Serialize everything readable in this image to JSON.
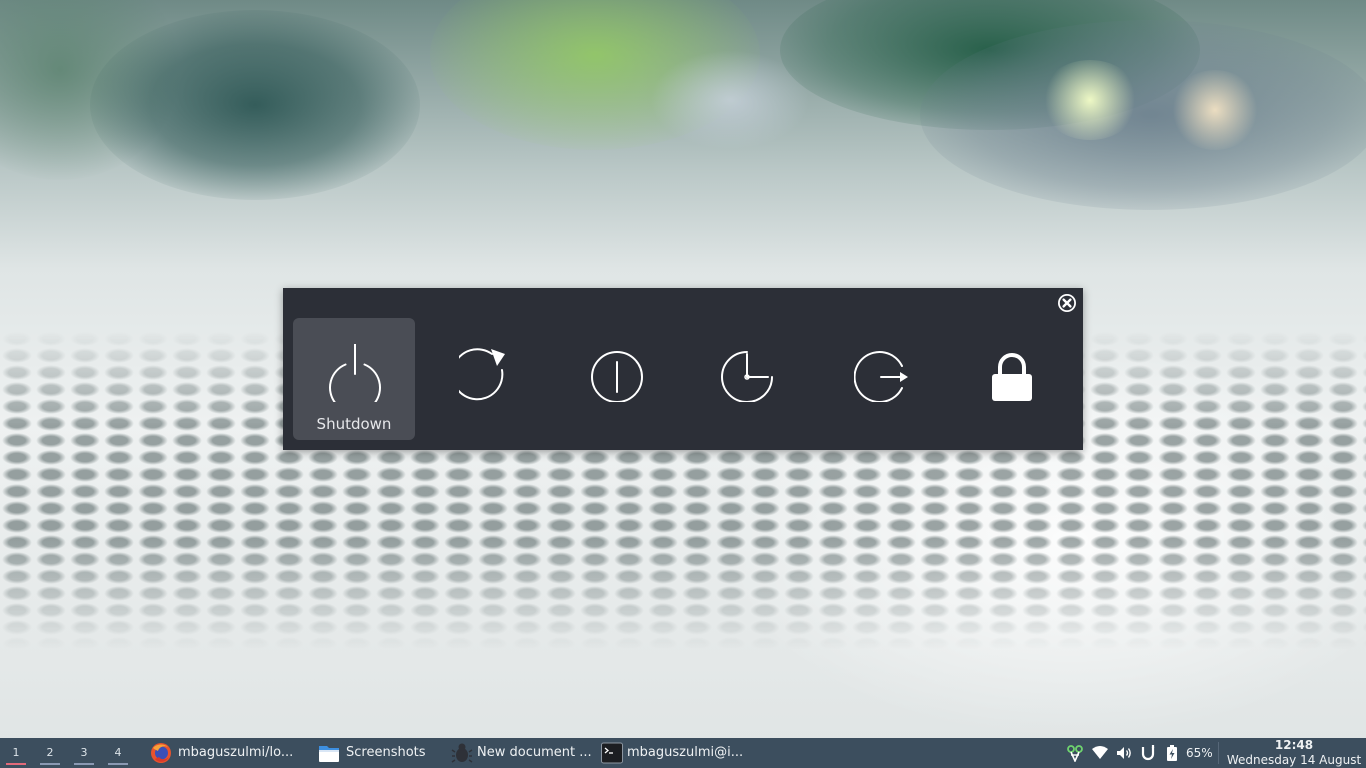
{
  "dialog": {
    "options": [
      {
        "id": "shutdown",
        "label": "Shutdown",
        "icon": "power-icon",
        "selected": true
      },
      {
        "id": "restart",
        "label": "",
        "icon": "restart-icon",
        "selected": false
      },
      {
        "id": "suspend",
        "label": "",
        "icon": "suspend-icon",
        "selected": false
      },
      {
        "id": "hibernate",
        "label": "",
        "icon": "hibernate-clock-icon",
        "selected": false
      },
      {
        "id": "logout",
        "label": "",
        "icon": "logout-icon",
        "selected": false
      },
      {
        "id": "lock",
        "label": "",
        "icon": "lock-icon",
        "selected": false
      }
    ],
    "close_icon": "close-icon"
  },
  "taskbar": {
    "workspaces": [
      {
        "label": "1",
        "active": true
      },
      {
        "label": "2",
        "active": false
      },
      {
        "label": "3",
        "active": false
      },
      {
        "label": "4",
        "active": false
      }
    ],
    "tasks": [
      {
        "label": "mbaguszulmi/lo...",
        "icon": "firefox-icon"
      },
      {
        "label": "Screenshots",
        "icon": "folder-icon"
      },
      {
        "label": "New document ...",
        "icon": "editor-icon"
      },
      {
        "label": "mbaguszulmi@i...",
        "icon": "terminal-icon"
      }
    ],
    "tray": {
      "icons": [
        "network-manager-icon",
        "wifi-icon",
        "volume-icon",
        "power-plug-icon",
        "battery-icon"
      ],
      "battery_percent": "65%"
    },
    "clock": {
      "time": "12:48",
      "date": "Wednesday 14 August"
    }
  },
  "colors": {
    "dialog_bg": "#2c2f37",
    "selected_bg": "#4a4d55",
    "taskbar_bg": "#3c4e5e",
    "active_workspace": "#e26a7a",
    "inactive_workspace": "#8a98b2"
  }
}
